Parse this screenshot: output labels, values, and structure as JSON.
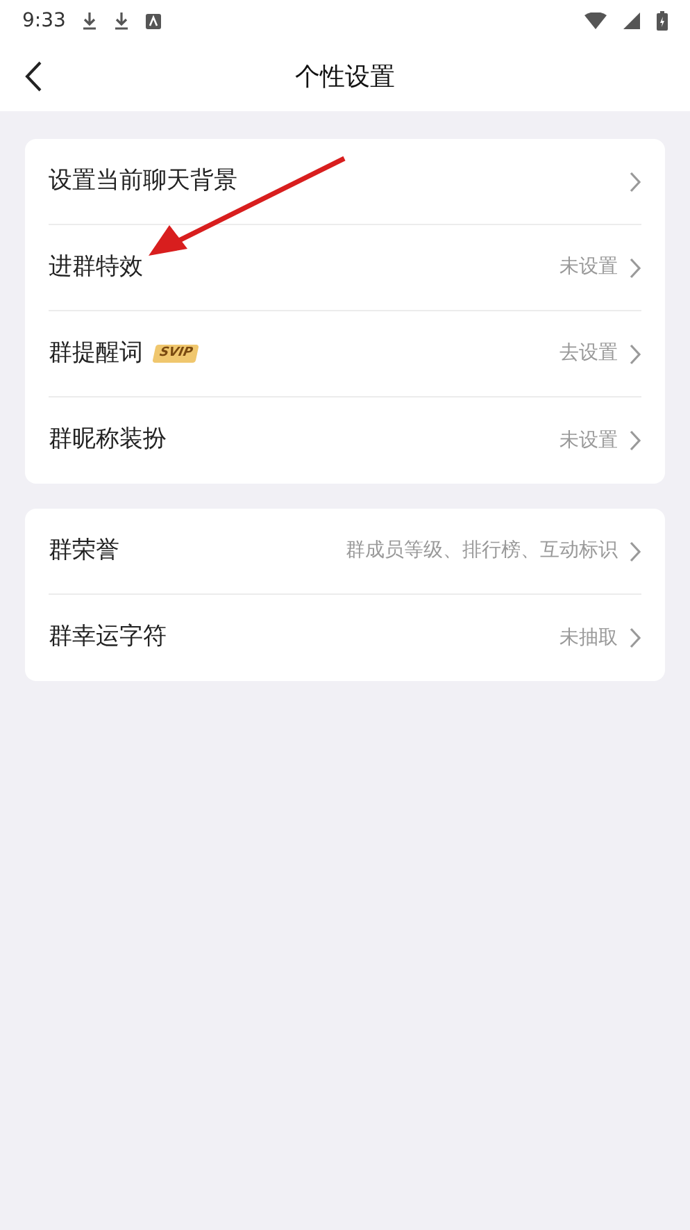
{
  "status_bar": {
    "time": "9:33"
  },
  "header": {
    "title": "个性设置"
  },
  "groups": [
    {
      "items": [
        {
          "label": "设置当前聊天背景"
        },
        {
          "label": "进群特效",
          "value": "未设置"
        },
        {
          "label": "群提醒词",
          "badge": "SVIP",
          "value": "去设置"
        },
        {
          "label": "群昵称装扮",
          "value": "未设置"
        }
      ]
    },
    {
      "items": [
        {
          "label": "群荣誉",
          "value": "群成员等级、排行榜、互动标识"
        },
        {
          "label": "群幸运字符",
          "value": "未抽取"
        }
      ]
    }
  ]
}
